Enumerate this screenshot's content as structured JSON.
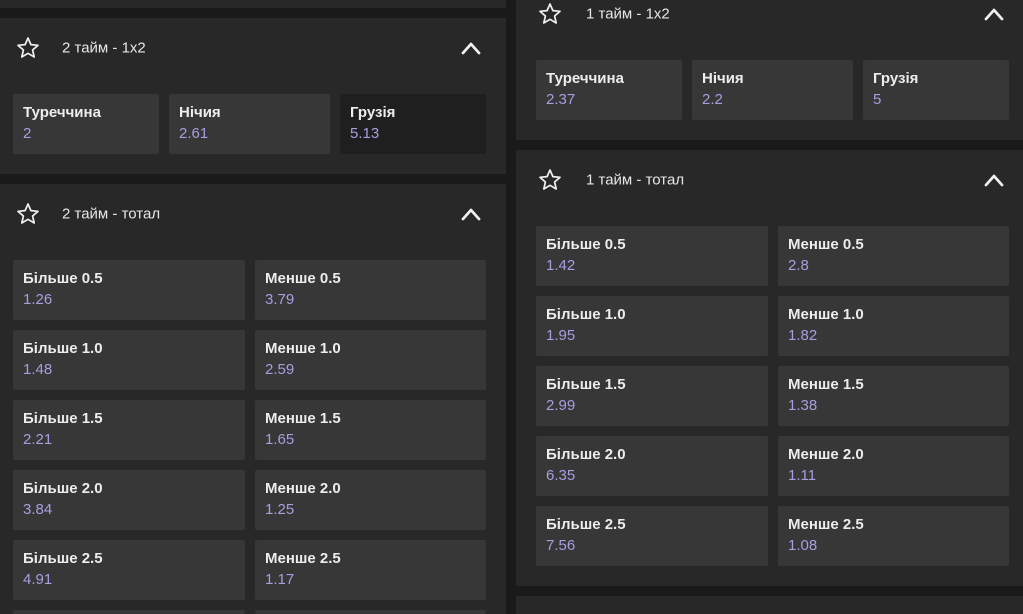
{
  "colors": {
    "background": "#1a1a1a",
    "panel": "#282828",
    "cell": "#373737",
    "cell_selected": "#1f1f1f",
    "odd_value": "#a79ee0",
    "text": "#ededed"
  },
  "icons": {
    "favorite": "star-outline-icon",
    "collapse": "chevron-up-icon"
  },
  "left": {
    "second_half_1x2": {
      "title": "2 тайм - 1х2",
      "outcomes": [
        {
          "label": "Туреччина",
          "odd": "2"
        },
        {
          "label": "Нічия",
          "odd": "2.61"
        },
        {
          "label": "Грузія",
          "odd": "5.13"
        }
      ]
    },
    "second_half_total": {
      "title": "2 тайм - тотал",
      "outcomes": [
        {
          "label": "Більше 0.5",
          "odd": "1.26"
        },
        {
          "label": "Менше 0.5",
          "odd": "3.79"
        },
        {
          "label": "Більше 1.0",
          "odd": "1.48"
        },
        {
          "label": "Менше 1.0",
          "odd": "2.59"
        },
        {
          "label": "Більше 1.5",
          "odd": "2.21"
        },
        {
          "label": "Менше 1.5",
          "odd": "1.65"
        },
        {
          "label": "Більше 2.0",
          "odd": "3.84"
        },
        {
          "label": "Менше 2.0",
          "odd": "1.25"
        },
        {
          "label": "Більше 2.5",
          "odd": "4.91"
        },
        {
          "label": "Менше 2.5",
          "odd": "1.17"
        }
      ]
    }
  },
  "right": {
    "first_half_1x2": {
      "title": "1 тайм - 1х2",
      "outcomes": [
        {
          "label": "Туреччина",
          "odd": "2.37"
        },
        {
          "label": "Нічия",
          "odd": "2.2"
        },
        {
          "label": "Грузія",
          "odd": "5"
        }
      ]
    },
    "first_half_total": {
      "title": "1 тайм - тотал",
      "outcomes": [
        {
          "label": "Більше 0.5",
          "odd": "1.42"
        },
        {
          "label": "Менше 0.5",
          "odd": "2.8"
        },
        {
          "label": "Більше 1.0",
          "odd": "1.95"
        },
        {
          "label": "Менше 1.0",
          "odd": "1.82"
        },
        {
          "label": "Більше 1.5",
          "odd": "2.99"
        },
        {
          "label": "Менше 1.5",
          "odd": "1.38"
        },
        {
          "label": "Більше 2.0",
          "odd": "6.35"
        },
        {
          "label": "Менше 2.0",
          "odd": "1.11"
        },
        {
          "label": "Більше 2.5",
          "odd": "7.56"
        },
        {
          "label": "Менше 2.5",
          "odd": "1.08"
        }
      ]
    }
  }
}
